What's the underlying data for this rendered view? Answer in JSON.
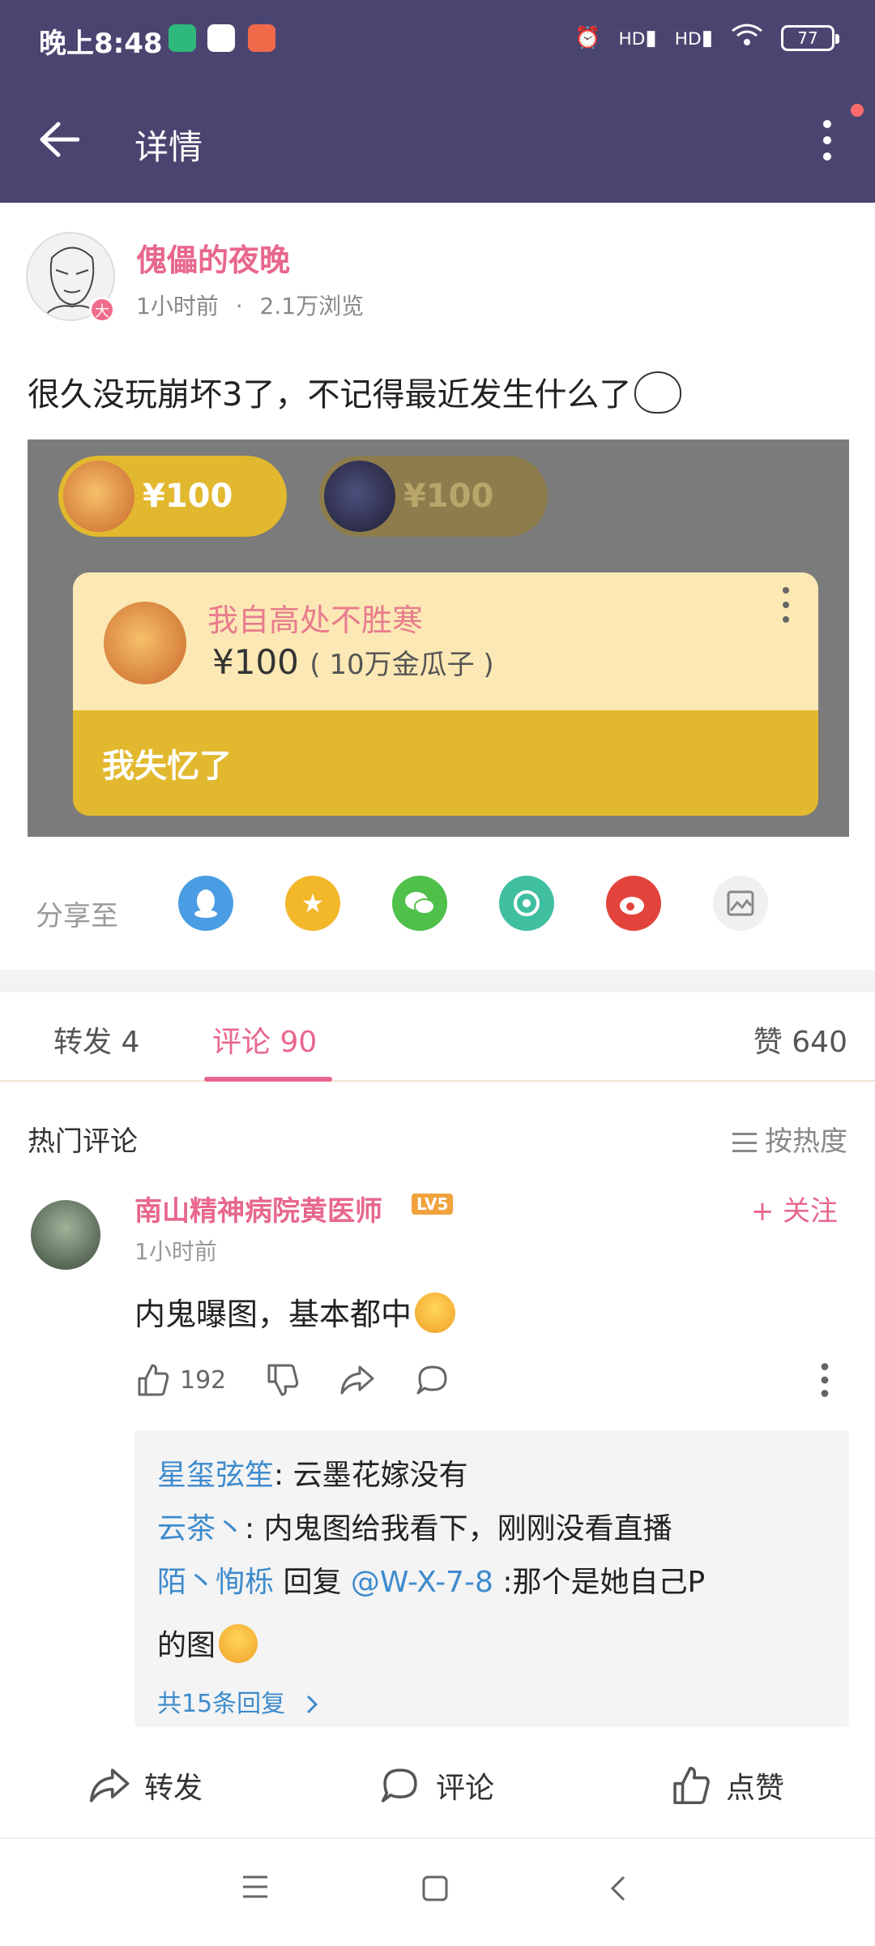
{
  "status_bar": {
    "time": "晚上8:48",
    "battery": "77",
    "network_labels": [
      "HD",
      "HD"
    ]
  },
  "app_bar": {
    "title": "详情",
    "back_icon": "arrow-left-icon",
    "more_icon": "more-vertical-icon"
  },
  "author": {
    "name": "傀儡的夜晚",
    "badge": "大",
    "time": "1小时前",
    "separator": "·",
    "views": "2.1万浏览"
  },
  "post": {
    "text": "很久没玩崩坏3了，不记得最近发生什么了"
  },
  "post_image": {
    "pill_left_value": "¥100",
    "pill_right_value": "¥100",
    "card_name": "我自高处不胜寒",
    "card_amount": "¥100",
    "card_amount_note": "( 10万金瓜子 )",
    "card_message": "我失忆了"
  },
  "share": {
    "label": "分享至",
    "targets": [
      "qq-icon",
      "qzone-icon",
      "wechat-icon",
      "moments-icon",
      "weibo-icon",
      "save-image-icon"
    ]
  },
  "tabs": {
    "repost": "转发 4",
    "comments": "评论 90",
    "likes": "赞 640"
  },
  "comments_header": {
    "title": "热门评论",
    "sort": "按热度"
  },
  "comment": {
    "name": "南山精神病院黄医师",
    "level": "LV5",
    "follow": "+ 关注",
    "time": "1小时前",
    "text": "内鬼曝图，基本都中",
    "like_count": "192"
  },
  "replies": {
    "r1_user": "星玺弦笙",
    "r1_text": ": 云墨花嫁没有",
    "r2_user": "云茶丶",
    "r2_text": ": 内鬼图给我看下，刚刚没看直播",
    "r3_user": "陌丶恂栎",
    "r3_mid": " 回复 ",
    "r3_target": "@W-X-7-8",
    "r3_text": " :那个是她自己P",
    "r3_text2": "的图",
    "total": "共15条回复"
  },
  "bottom_actions": {
    "repost": "转发",
    "comment": "评论",
    "like": "点赞"
  },
  "colors": {
    "header_bg": "#4a4570",
    "accent_pink": "#e8678c",
    "link_blue": "#3d8bcd"
  }
}
